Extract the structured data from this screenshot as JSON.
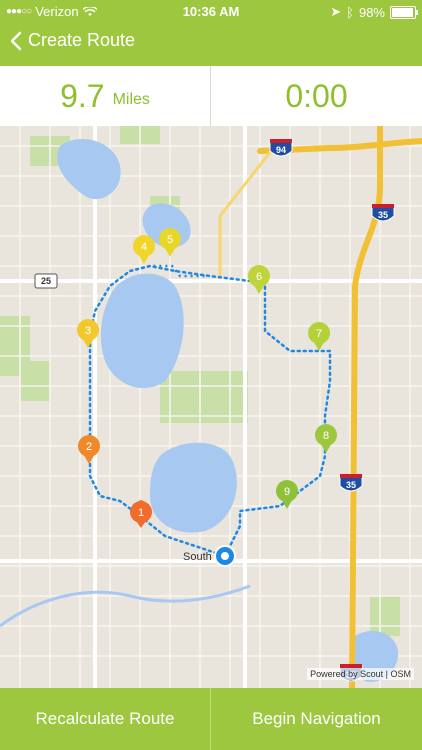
{
  "status_bar": {
    "carrier": "Verizon",
    "time": "10:36 AM",
    "battery": "98%",
    "battery_level": 0.98
  },
  "header": {
    "back_label": "Create Route"
  },
  "stats": {
    "distance_value": "9.7",
    "distance_unit": "Miles",
    "duration": "0:00"
  },
  "map": {
    "highway_labels": [
      "94",
      "35",
      "35",
      "35",
      "25"
    ],
    "location_label": "South",
    "waypoints": [
      "1",
      "2",
      "3",
      "4",
      "5",
      "6",
      "7",
      "8",
      "9"
    ],
    "attribution": "Powered by Scout | OSM",
    "colors": {
      "route": "#1e88e5",
      "water": "#a7c8f0",
      "park": "#c8dfa8"
    }
  },
  "buttons": {
    "recalculate": "Recalculate Route",
    "begin": "Begin Navigation"
  }
}
